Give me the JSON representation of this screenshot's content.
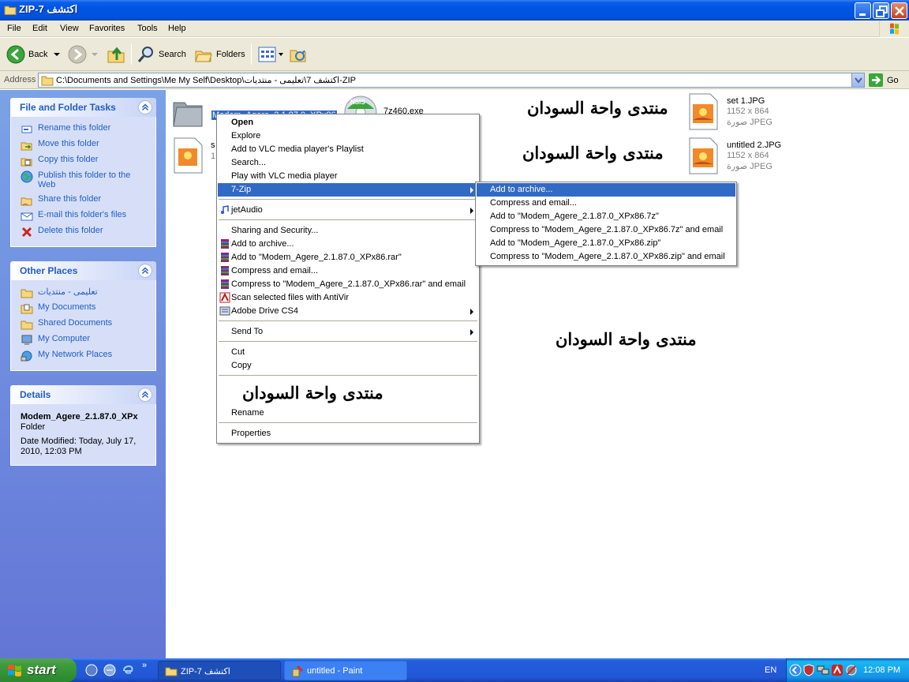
{
  "window": {
    "title": "اكتشف 7-ZIP"
  },
  "menubar": {
    "items": [
      "File",
      "Edit",
      "View",
      "Favorites",
      "Tools",
      "Help"
    ]
  },
  "toolbar": {
    "back_label": "Back",
    "search_label": "Search",
    "folders_label": "Folders"
  },
  "address": {
    "label": "Address",
    "value": "C:\\Documents and Settings\\Me My Self\\Desktop\\اكتشف 7\\تعليمى - منتديات-ZIP",
    "go_label": "Go"
  },
  "tasks": {
    "file_folder": {
      "title": "File and Folder Tasks",
      "items": [
        {
          "label": "Rename this folder",
          "icon": "rename-icon"
        },
        {
          "label": "Move this folder",
          "icon": "move-icon"
        },
        {
          "label": "Copy this folder",
          "icon": "copy-icon"
        },
        {
          "label": "Publish this folder to the Web",
          "icon": "globe-icon"
        },
        {
          "label": "Share this folder",
          "icon": "share-icon"
        },
        {
          "label": "E-mail this folder's files",
          "icon": "email-icon"
        },
        {
          "label": "Delete this folder",
          "icon": "delete-icon"
        }
      ]
    },
    "other_places": {
      "title": "Other Places",
      "items": [
        {
          "label": "تعليمى - منتديات",
          "icon": "folder-icon"
        },
        {
          "label": "My Documents",
          "icon": "documents-icon"
        },
        {
          "label": "Shared Documents",
          "icon": "folder-icon"
        },
        {
          "label": "My Computer",
          "icon": "computer-icon"
        },
        {
          "label": "My Network Places",
          "icon": "network-icon"
        }
      ]
    },
    "details": {
      "title": "Details",
      "name": "Modem_Agere_2.1.87.0_XPx",
      "type": "Folder",
      "modified": "Date Modified: Today, July 17, 2010, 12:03 PM"
    }
  },
  "files": {
    "folder_name": "Modem_Agere_2.1.87.0_XPx86",
    "exe_name": "7z460.exe",
    "exe_badge": "NSIS",
    "hidden_s_prefix": "s",
    "hidden_s_sub": "1",
    "set1": {
      "name": "set 1.JPG",
      "dims": "1152 x 864",
      "type": "صورة JPEG"
    },
    "untitled2": {
      "name": "untitled 2.JPG",
      "dims": "1152 x 864",
      "type": "صورة JPEG"
    }
  },
  "watermarks": [
    "منتدى واحة السودان",
    "منتدى واحة السودان",
    "منتدى واحة السودان",
    "منتدى واحة السودان"
  ],
  "context_menu": {
    "items": [
      {
        "label": "Open",
        "bold": true
      },
      {
        "label": "Explore"
      },
      {
        "label": "Add to VLC media player's Playlist"
      },
      {
        "label": "Search..."
      },
      {
        "label": "Play with VLC media player"
      },
      {
        "label": "7-Zip"
      },
      {
        "label": "jetAudio"
      },
      {
        "label": "Sharing and Security..."
      },
      {
        "label": "Add to archive..."
      },
      {
        "label": "Add to \"Modem_Agere_2.1.87.0_XPx86.rar\""
      },
      {
        "label": "Compress and email..."
      },
      {
        "label": "Compress to \"Modem_Agere_2.1.87.0_XPx86.rar\" and email"
      },
      {
        "label": "Scan selected files with AntiVir"
      },
      {
        "label": "Adobe Drive CS4"
      },
      {
        "label": "Send To"
      },
      {
        "label": "Cut"
      },
      {
        "label": "Copy"
      },
      {
        "label": "Rename"
      },
      {
        "label": "Properties"
      }
    ]
  },
  "submenu_7zip": {
    "items": [
      {
        "label": "Add to archive..."
      },
      {
        "label": "Compress and email..."
      },
      {
        "label": "Add to \"Modem_Agere_2.1.87.0_XPx86.7z\""
      },
      {
        "label": "Compress to \"Modem_Agere_2.1.87.0_XPx86.7z\" and email"
      },
      {
        "label": "Add to \"Modem_Agere_2.1.87.0_XPx86.zip\""
      },
      {
        "label": "Compress to \"Modem_Agere_2.1.87.0_XPx86.zip\" and email"
      }
    ]
  },
  "taskbar": {
    "start_label": "start",
    "tasks": [
      {
        "label": "اكتشف 7-ZIP",
        "active": true
      },
      {
        "label": "untitled - Paint",
        "active": false
      }
    ],
    "language": "EN",
    "clock": "12:08 PM"
  },
  "colors": {
    "selection": "#316ac5",
    "taskpane": "#6375d6",
    "link": "#215dc6"
  }
}
